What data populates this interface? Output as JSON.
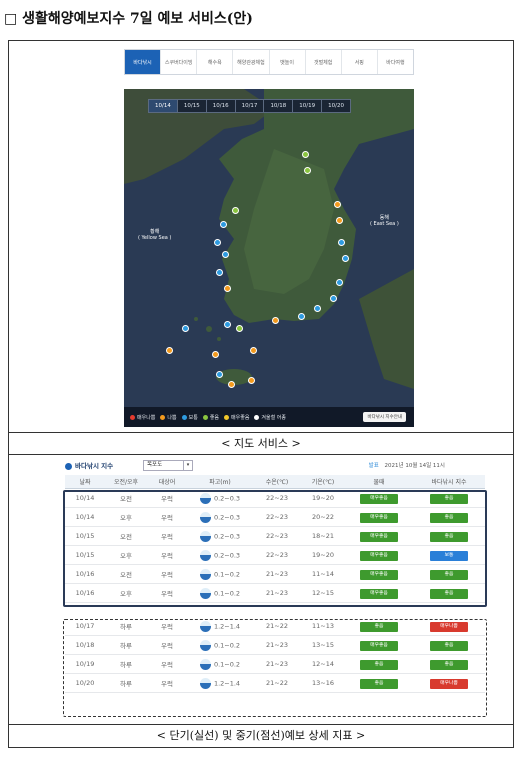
{
  "document": {
    "title": "□ 생활해양예보지수 7일 예보 서비스(안)",
    "map_caption": "< 지도 서비스 >",
    "table_caption": "< 단기(실선) 및 중기(점선)예보 상세 지표 >"
  },
  "map_service": {
    "tabs": [
      "바다낚시",
      "스쿠버다이빙",
      "해수욕",
      "해양관광체험",
      "뱃놀이",
      "갯벌체험",
      "서핑",
      "바다여행"
    ],
    "active_tab": 0,
    "dates": [
      "10/14",
      "10/15",
      "10/16",
      "10/17",
      "10/18",
      "10/19",
      "10/20"
    ],
    "active_date": 0,
    "sea_labels": {
      "yellow": "황해\n( Yellow Sea )",
      "east": "동해\n( East Sea )"
    },
    "legend": [
      {
        "label": "매우나쁨",
        "color": "#e63b2e"
      },
      {
        "label": "나쁨",
        "color": "#f39a1e"
      },
      {
        "label": "보통",
        "color": "#2e9be0"
      },
      {
        "label": "좋음",
        "color": "#8ac43f"
      },
      {
        "label": "매우좋음",
        "color": "#f1c72a"
      },
      {
        "label": "겨울철 어종",
        "color": "#ffffff"
      }
    ],
    "button_label": "바다낚시 지수안내",
    "colors": {
      "accent": "#1c62b5",
      "sea": "#2c3b52",
      "land": "#3d5a3a"
    }
  },
  "forecast_table": {
    "title": "바다낚시 지수",
    "region": "목포도",
    "announce_kw": "발표",
    "announce_time": "2021년 10월 14일 11시",
    "columns": [
      "날짜",
      "오전/오후",
      "대상어",
      "파고(m)",
      "수온(℃)",
      "기온(℃)",
      "물때",
      "바다낚시 지수"
    ],
    "rows": [
      {
        "date": "10/14",
        "ampm": "오전",
        "fish": "우럭",
        "wave": "0.2~0.3",
        "water": "22~23",
        "air": "19~20",
        "tide": "매우좋음",
        "tide_color": "green",
        "index": "좋음",
        "index_color": "green"
      },
      {
        "date": "10/14",
        "ampm": "오후",
        "fish": "우럭",
        "wave": "0.2~0.3",
        "water": "22~23",
        "air": "20~22",
        "tide": "매우좋음",
        "tide_color": "green",
        "index": "좋음",
        "index_color": "green"
      },
      {
        "date": "10/15",
        "ampm": "오전",
        "fish": "우럭",
        "wave": "0.2~0.3",
        "water": "22~23",
        "air": "18~21",
        "tide": "매우좋음",
        "tide_color": "green",
        "index": "좋음",
        "index_color": "green"
      },
      {
        "date": "10/15",
        "ampm": "오후",
        "fish": "우럭",
        "wave": "0.2~0.3",
        "water": "22~23",
        "air": "19~20",
        "tide": "매우좋음",
        "tide_color": "green",
        "index": "보통",
        "index_color": "blue"
      },
      {
        "date": "10/16",
        "ampm": "오전",
        "fish": "우럭",
        "wave": "0.1~0.2",
        "water": "21~23",
        "air": "11~14",
        "tide": "매우좋음",
        "tide_color": "green",
        "index": "좋음",
        "index_color": "green"
      },
      {
        "date": "10/16",
        "ampm": "오후",
        "fish": "우럭",
        "wave": "0.1~0.2",
        "water": "21~23",
        "air": "12~15",
        "tide": "매우좋음",
        "tide_color": "green",
        "index": "좋음",
        "index_color": "green"
      },
      {
        "date": "10/17",
        "ampm": "하루",
        "fish": "우럭",
        "wave": "1.2~1.4",
        "water": "21~22",
        "air": "11~13",
        "tide": "좋음",
        "tide_color": "green",
        "index": "매우나쁨",
        "index_color": "red"
      },
      {
        "date": "10/18",
        "ampm": "하루",
        "fish": "우럭",
        "wave": "0.1~0.2",
        "water": "21~23",
        "air": "13~15",
        "tide": "매우좋음",
        "tide_color": "green",
        "index": "좋음",
        "index_color": "green"
      },
      {
        "date": "10/19",
        "ampm": "하루",
        "fish": "우럭",
        "wave": "0.1~0.2",
        "water": "21~23",
        "air": "12~14",
        "tide": "좋음",
        "tide_color": "green",
        "index": "좋음",
        "index_color": "green"
      },
      {
        "date": "10/20",
        "ampm": "하루",
        "fish": "우럭",
        "wave": "1.2~1.4",
        "water": "21~22",
        "air": "13~16",
        "tide": "좋음",
        "tide_color": "green",
        "index": "매우나쁨",
        "index_color": "red"
      }
    ]
  }
}
